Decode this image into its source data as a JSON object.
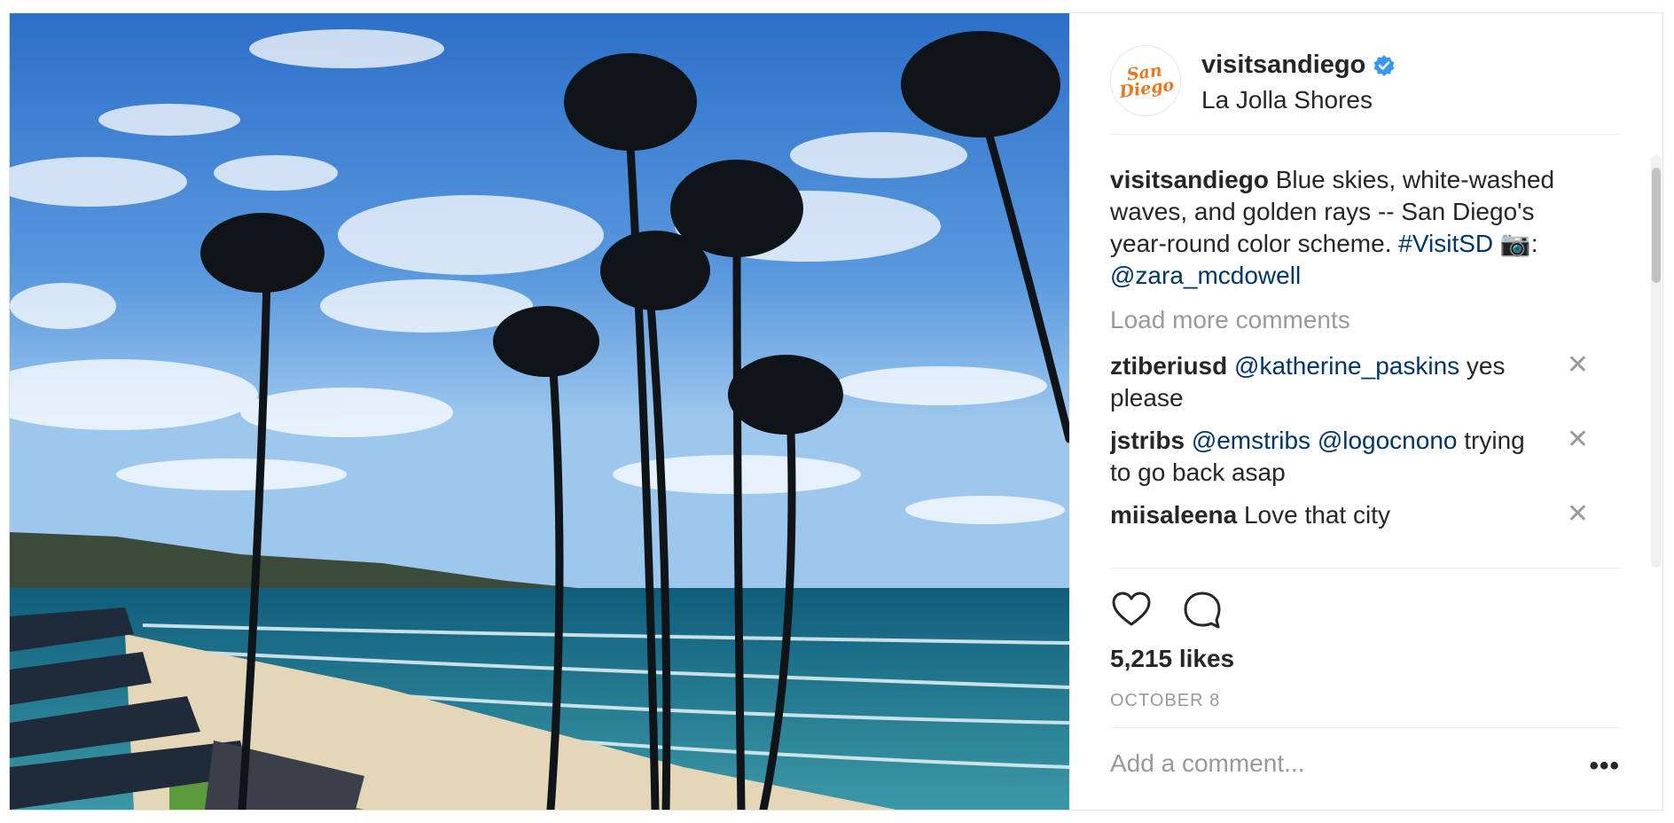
{
  "post": {
    "username": "visitsandiego",
    "location": "La Jolla Shores",
    "avatar_text": "San Diego",
    "caption": {
      "username": "visitsandiego",
      "text": " Blue skies, white-washed waves, and golden rays -- San Diego's year-round color scheme. ",
      "hashtag": "#VisitSD",
      "camera_icon": "📷",
      "colon": ":",
      "mention": "@zara_mcdowell"
    },
    "load_more": "Load more comments",
    "comments": [
      {
        "user": "ztiberiusd",
        "mentions": [
          "@katherine_paskins"
        ],
        "text": " yes please"
      },
      {
        "user": "jstribs",
        "mentions": [
          "@emstribs",
          "@logocnono"
        ],
        "text": " trying to go back asap"
      },
      {
        "user": "miisaleena",
        "mentions": [],
        "text": "Love that city"
      }
    ],
    "likes": "5,215 likes",
    "date": "OCTOBER 8",
    "add_comment_placeholder": "Add a comment...",
    "more_label": "•••",
    "close_label": "✕"
  },
  "colors": {
    "link": "#003569",
    "verified": "#3897f0",
    "brand": "#e8771f",
    "muted": "#999999"
  },
  "icons": [
    "verified-badge-icon",
    "heart-icon",
    "comment-icon",
    "close-icon",
    "more-options-icon"
  ]
}
